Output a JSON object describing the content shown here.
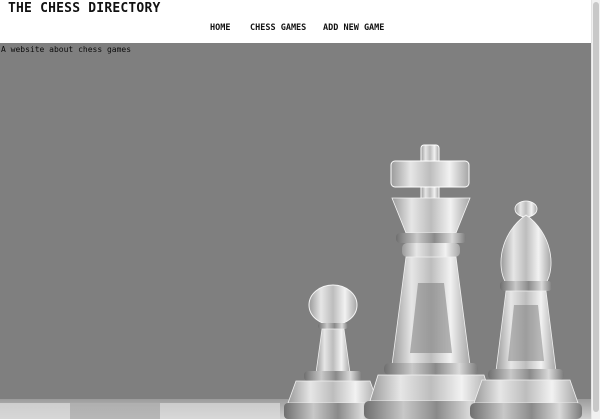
{
  "header": {
    "site_title": "THE CHESS DIRECTORY"
  },
  "nav": {
    "items": [
      {
        "label": "HOME"
      },
      {
        "label": "CHESS GAMES"
      },
      {
        "label": "ADD NEW GAME"
      }
    ]
  },
  "hero": {
    "tagline": "A website about chess games",
    "image_subject": "glass chess pieces: pawn, king, bishop",
    "background_color": "#7f7f7f"
  },
  "colors": {
    "header_bg": "#ffffff",
    "text": "#111111"
  }
}
